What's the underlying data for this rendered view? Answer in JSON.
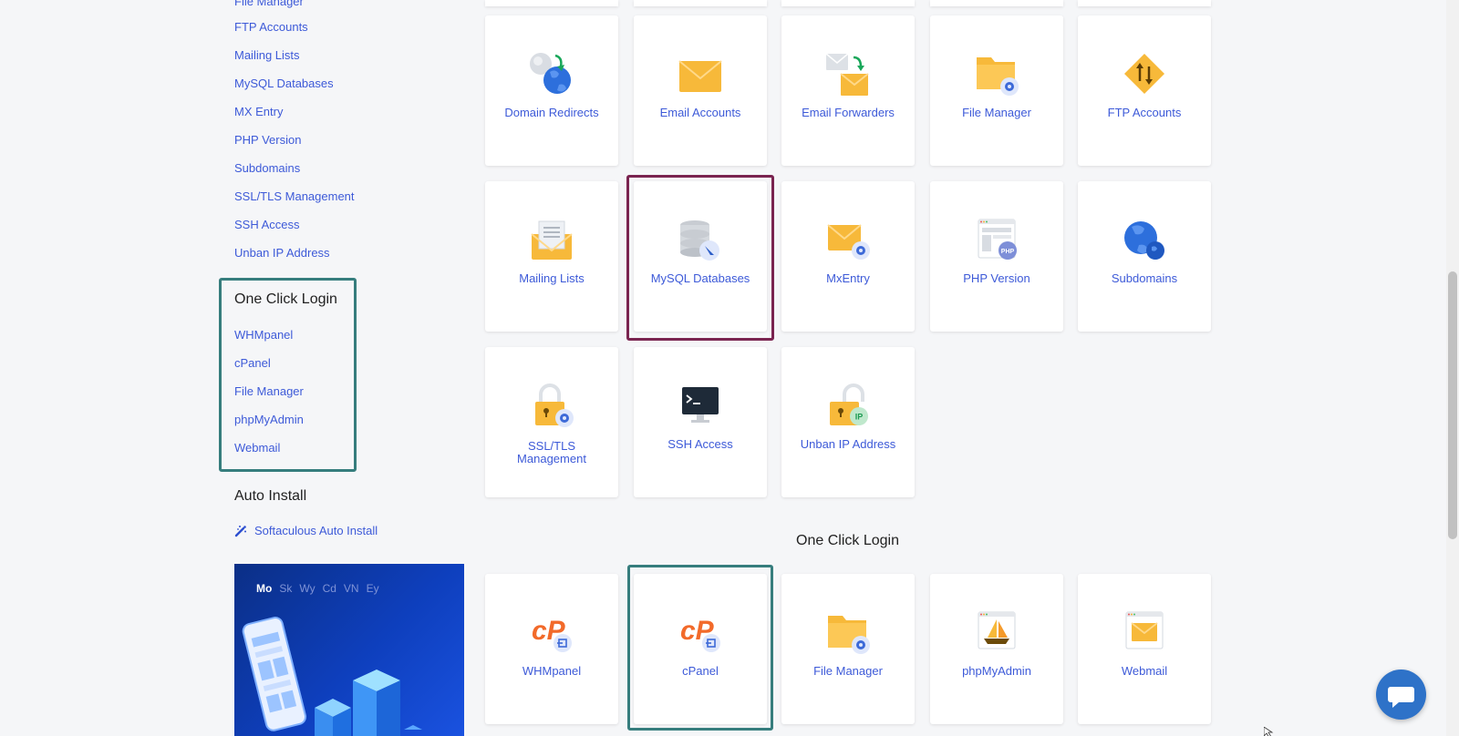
{
  "sidebar": {
    "top_links": [
      "File Manager",
      "FTP Accounts",
      "Mailing Lists",
      "MySQL Databases",
      "MX Entry",
      "PHP Version",
      "Subdomains",
      "SSL/TLS Management",
      "SSH Access",
      "Unban IP Address"
    ],
    "one_click": {
      "heading": "One Click Login",
      "links": [
        "WHMpanel",
        "cPanel",
        "File Manager",
        "phpMyAdmin",
        "Webmail"
      ]
    },
    "auto_install": {
      "heading": "Auto Install",
      "link": "Softaculous Auto Install"
    },
    "promo": {
      "tabs": [
        "Mo",
        "Sk",
        "Wy",
        "Cd",
        "VN",
        "Ey"
      ],
      "active_tab": "Mo"
    }
  },
  "tools": {
    "row1": [
      "Domain Redirects",
      "Email Accounts",
      "Email Forwarders",
      "File Manager",
      "FTP Accounts"
    ],
    "row2": [
      "Mailing Lists",
      "MySQL Databases",
      "MxEntry",
      "PHP Version",
      "Subdomains"
    ],
    "row3": [
      "SSL/TLS\nManagement",
      "SSH Access",
      "Unban IP Address"
    ],
    "row3_ssl_line1": "SSL/TLS",
    "row3_ssl_line2": "Management",
    "row3_ssh": "SSH Access",
    "row3_unban": "Unban IP Address"
  },
  "one_click_section": {
    "title": "One Click Login",
    "tiles": [
      "WHMpanel",
      "cPanel",
      "File Manager",
      "phpMyAdmin",
      "Webmail"
    ]
  },
  "icons": {
    "domain_redirects": "globe-redirect-icon",
    "email_accounts": "envelope-icon",
    "email_forwarders": "envelope-forward-icon",
    "file_manager": "folder-gear-icon",
    "ftp_accounts": "ftp-arrows-icon",
    "mailing_lists": "envelope-list-icon",
    "mysql": "database-icon",
    "mx_entry": "envelope-gear-icon",
    "php_version": "php-window-icon",
    "subdomains": "globe-icon",
    "ssl": "lock-gear-icon",
    "ssh": "terminal-icon",
    "unban": "lock-ip-icon",
    "cpanel": "cpanel-logo-icon",
    "phpmyadmin": "phpmyadmin-icon",
    "webmail": "webmail-window-icon",
    "chat": "chat-bubble-icon"
  },
  "colors": {
    "link": "#3d5ad8",
    "highlight_teal": "#367d7d",
    "highlight_maroon": "#7a2450",
    "icon_yellow": "#f7b93a",
    "icon_blue": "#2d6fdc",
    "cpanel_orange": "#f26a2a"
  }
}
